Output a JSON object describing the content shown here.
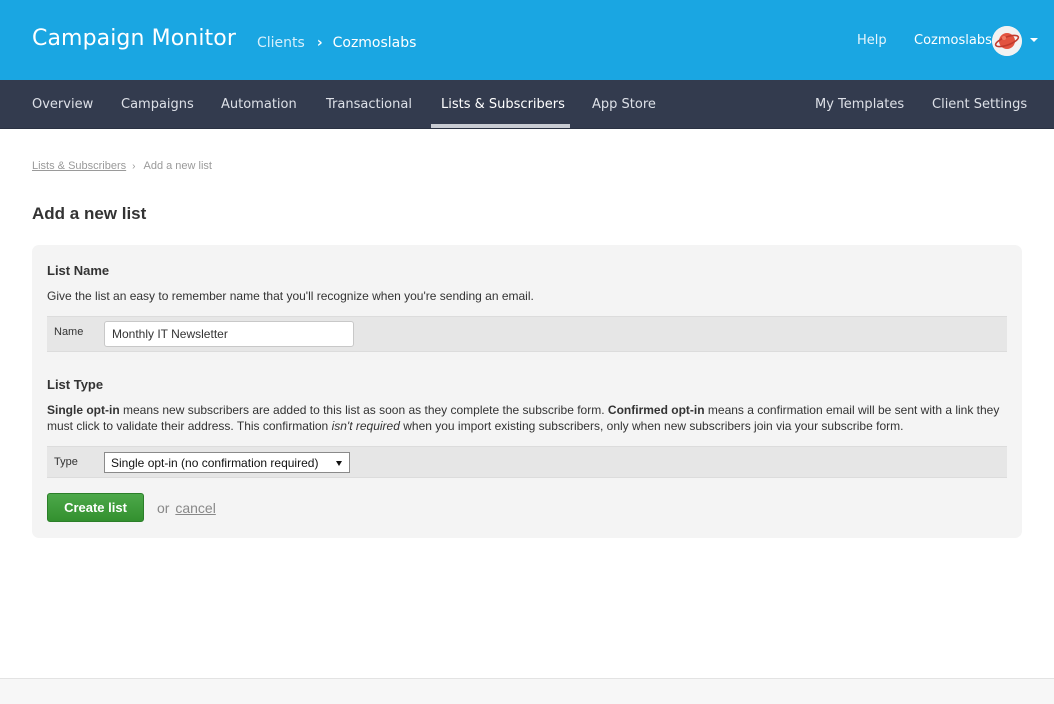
{
  "header": {
    "brand": "Campaign Monitor",
    "clients_link": "Clients",
    "separator": "›",
    "client_name": "Cozmoslabs",
    "help": "Help",
    "user_name": "Cozmoslabs",
    "avatar_icon": "planet-icon",
    "dropdown_icon": "caret-down-icon",
    "bg_color": "#1aa6e2"
  },
  "nav": {
    "items": [
      {
        "label": "Overview"
      },
      {
        "label": "Campaigns"
      },
      {
        "label": "Automation"
      },
      {
        "label": "Transactional"
      },
      {
        "label": "Lists & Subscribers",
        "active": true
      },
      {
        "label": "App Store"
      }
    ],
    "right_items": [
      {
        "label": "My Templates"
      },
      {
        "label": "Client Settings"
      }
    ],
    "bg_color": "#333b4e"
  },
  "breadcrumb": {
    "parent": "Lists & Subscribers",
    "separator": "›",
    "current": "Add a new list"
  },
  "page": {
    "title": "Add a new list"
  },
  "list_name": {
    "title": "List Name",
    "description": "Give the list an easy to remember name that you'll recognize when you're sending an email.",
    "field_label": "Name",
    "field_value": "Monthly IT Newsletter"
  },
  "list_type": {
    "title": "List Type",
    "desc_bold_1": "Single opt-in",
    "desc_text_1": " means new subscribers are added to this list as soon as they complete the subscribe form. ",
    "desc_bold_2": "Confirmed opt-in",
    "desc_text_2": " means a confirmation email will be sent with a link they must click to validate their address. This confirmation ",
    "desc_italic": "isn't required",
    "desc_text_3": " when you import existing subscribers, only when new subscribers join via your subscribe form.",
    "field_label": "Type",
    "selected_option": "Single opt-in (no confirmation required)"
  },
  "actions": {
    "create_label": "Create list",
    "or_text": "or",
    "cancel_label": "cancel",
    "create_color": "#3a9a37"
  }
}
